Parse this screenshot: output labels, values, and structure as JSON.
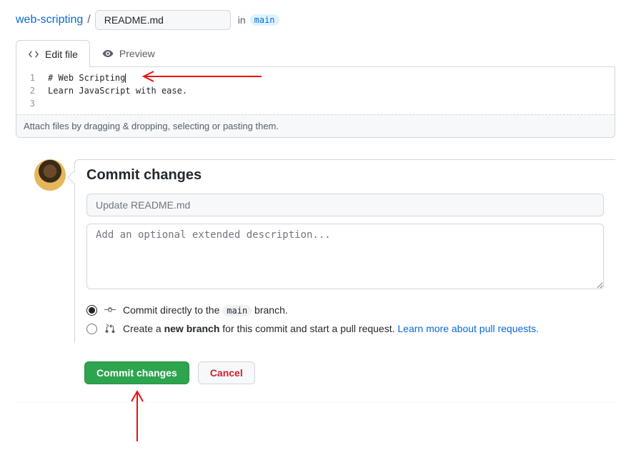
{
  "breadcrumb": {
    "repo": "web-scripting",
    "separator": "/",
    "filename": "README.md",
    "in": "in",
    "branch": "main"
  },
  "tabs": {
    "edit": "Edit file",
    "preview": "Preview"
  },
  "editor": {
    "lines": {
      "l1": {
        "num": "1",
        "text": "# Web Scripting"
      },
      "l2": {
        "num": "2",
        "text": "Learn JavaScript with ease."
      },
      "l3": {
        "num": "3",
        "text": ""
      }
    }
  },
  "attach_hint": "Attach files by dragging & dropping, selecting or pasting them.",
  "commit": {
    "heading": "Commit changes",
    "summary_placeholder": "Update README.md",
    "description_placeholder": "Add an optional extended description...",
    "radio1_pre": "Commit directly to the ",
    "radio1_branch": "main",
    "radio1_post": " branch.",
    "radio2_pre": "Create a ",
    "radio2_bold": "new branch",
    "radio2_mid": " for this commit and start a pull request. ",
    "radio2_link": "Learn more about pull requests.",
    "commit_btn": "Commit changes",
    "cancel_btn": "Cancel"
  }
}
